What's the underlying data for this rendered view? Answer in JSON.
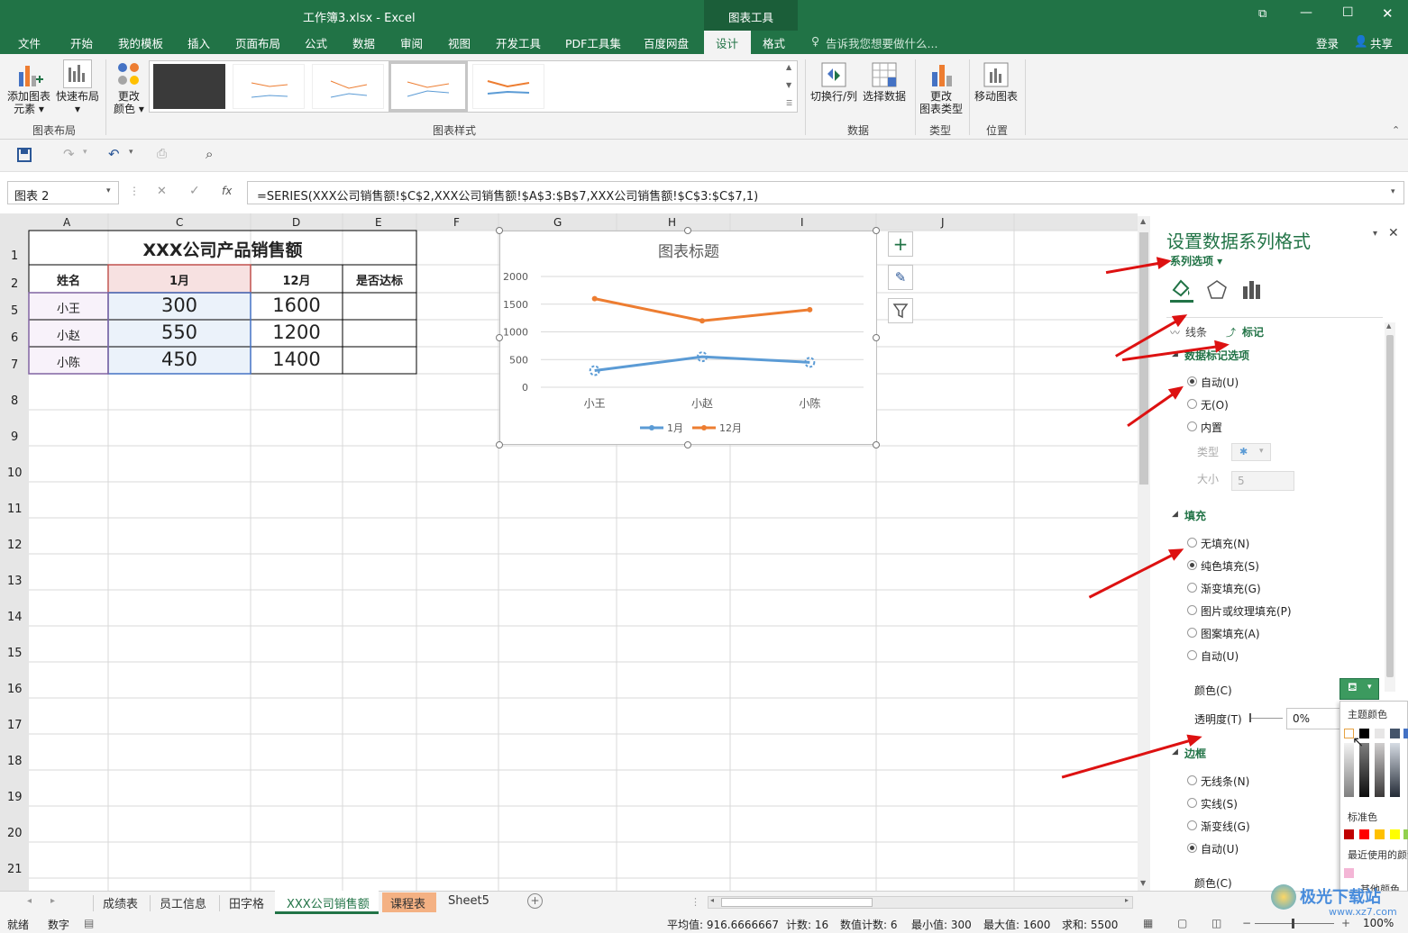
{
  "window": {
    "title": "工作簿3.xlsx - Excel",
    "context_tool": "图表工具",
    "controls": [
      "⧉",
      "—",
      "☐",
      "✕"
    ]
  },
  "ribbon_tabs": [
    "文件",
    "开始",
    "我的模板",
    "插入",
    "页面布局",
    "公式",
    "数据",
    "审阅",
    "视图",
    "开发工具",
    "PDF工具集",
    "百度网盘",
    "设计",
    "格式"
  ],
  "tell_me": "告诉我您想要做什么...",
  "login": "登录",
  "share": "共享",
  "ribbon": {
    "add_element": "添加图表\n元素 ▾",
    "quick_layout": "快速布局\n▾",
    "layout_group": "图表布局",
    "change_color": "更改\n颜色 ▾",
    "styles_group": "图表样式",
    "switch_rowcol": "切换行/列",
    "select_data": "选择数据",
    "data_group": "数据",
    "change_type": "更改\n图表类型",
    "type_group": "类型",
    "move_chart": "移动图表",
    "location_group": "位置"
  },
  "name_box": "图表 2",
  "formula": "=SERIES(XXX公司销售额!$C$2,XXX公司销售额!$A$3:$B$7,XXX公司销售额!$C$3:$C$7,1)",
  "fx": "fx",
  "columns": [
    "A",
    "C",
    "D",
    "E",
    "F",
    "G",
    "H",
    "I",
    "J"
  ],
  "rows": [
    "1",
    "2",
    "5",
    "6",
    "7",
    "8",
    "9",
    "10",
    "11",
    "12",
    "13",
    "14",
    "15",
    "16",
    "17",
    "18",
    "19",
    "20",
    "21"
  ],
  "table": {
    "title": "XXX公司产品销售额",
    "headers": [
      "姓名",
      "1月",
      "12月",
      "是否达标"
    ],
    "rows": [
      [
        "小王",
        "300",
        "1600",
        ""
      ],
      [
        "小赵",
        "550",
        "1200",
        ""
      ],
      [
        "小陈",
        "450",
        "1400",
        ""
      ]
    ]
  },
  "chart_data": {
    "type": "line",
    "title": "图表标题",
    "categories": [
      "小王",
      "小赵",
      "小陈"
    ],
    "series": [
      {
        "name": "1月",
        "values": [
          300,
          550,
          450
        ],
        "color": "#5b9bd5"
      },
      {
        "name": "12月",
        "values": [
          1600,
          1200,
          1400
        ],
        "color": "#ed7d31"
      }
    ],
    "ylim": [
      0,
      2000
    ],
    "yticks": [
      "0",
      "500",
      "1000",
      "1500",
      "2000"
    ],
    "legend": "bottom",
    "grid": true
  },
  "panel": {
    "title": "设置数据系列格式",
    "series_options": "系列选项 ▾",
    "sub_tabs": [
      "线条",
      "标记"
    ],
    "marker_options": "数据标记选项",
    "marker_radios": [
      "自动(U)",
      "无(O)",
      "内置"
    ],
    "type_label": "类型",
    "size_label": "大小",
    "size_value": "5",
    "fill": "填充",
    "fill_radios": [
      "无填充(N)",
      "纯色填充(S)",
      "渐变填充(G)",
      "图片或纹理填充(P)",
      "图案填充(A)",
      "自动(U)"
    ],
    "color_label": "颜色(C)",
    "transparency_label": "透明度(T)",
    "transparency_value": "0%",
    "border": "边框",
    "border_radios": [
      "无线条(N)",
      "实线(S)",
      "渐变线(G)",
      "自动(U)"
    ],
    "border_color": "颜色(C)",
    "theme_colors": "主题颜色",
    "standard_colors": "标准色",
    "recent_colors": "最近使用的颜色",
    "more_colors": "其他颜色"
  },
  "sheet_tabs": [
    "成绩表",
    "员工信息",
    "田字格",
    "XXX公司销售额",
    "课程表",
    "Sheet5"
  ],
  "status": {
    "ready": "就绪",
    "mode": "数字",
    "average": "平均值: 916.6666667",
    "count": "计数: 16",
    "num_count": "数值计数: 6",
    "min": "最小值: 300",
    "max": "最大值: 1600",
    "sum": "求和: 5500",
    "zoom": "100%"
  },
  "watermark": "极光下载站",
  "watermark_url": "www.xz7.com"
}
